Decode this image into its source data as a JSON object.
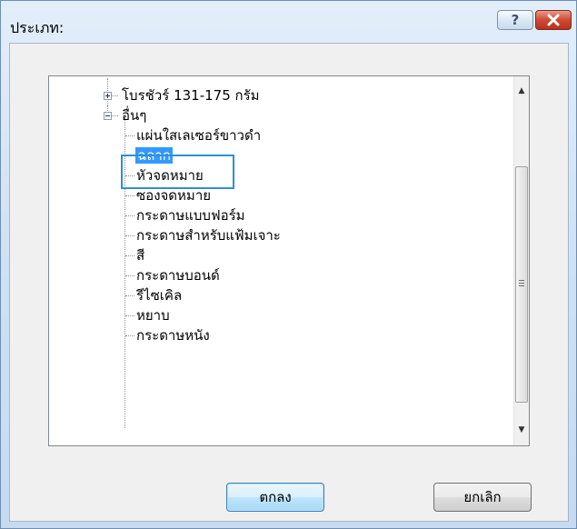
{
  "dialog": {
    "title": "ประเภท:",
    "help_symbol": "?",
    "close_symbol": "✕"
  },
  "tree": {
    "items": [
      {
        "label": "โบรชัวร์ 131-175 กรัม",
        "expander": "+"
      },
      {
        "label": "อื่นๆ",
        "expander": "-"
      },
      {
        "label": "แผ่นใสเลเซอร์ขาวดำ"
      },
      {
        "label": "ฉลาก",
        "selected": true
      },
      {
        "label": "หัวจดหมาย"
      },
      {
        "label": "ซองจดหมาย"
      },
      {
        "label": "กระดาษแบบฟอร์ม"
      },
      {
        "label": "กระดาษสำหรับแฟ้มเจาะ"
      },
      {
        "label": "สี"
      },
      {
        "label": "กระดาษบอนด์"
      },
      {
        "label": "รีไซเคิล"
      },
      {
        "label": "หยาบ"
      },
      {
        "label": "กระดาษหนัง"
      }
    ]
  },
  "buttons": {
    "ok": "ตกลง",
    "cancel": "ยกเลิก"
  },
  "colors": {
    "selection": "#3399ff",
    "focus_border": "#2f8fd8",
    "close_button": "#c8402b"
  }
}
